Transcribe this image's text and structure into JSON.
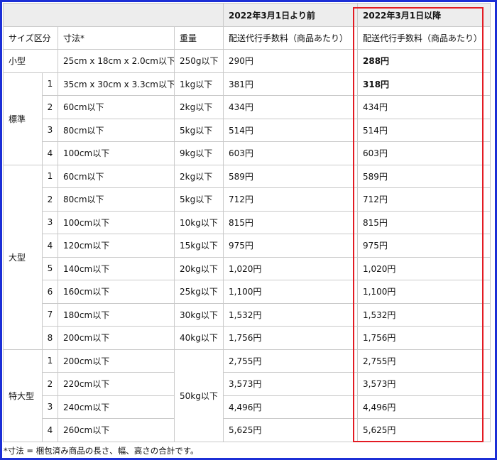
{
  "header": {
    "before_label": "2022年3月1日より前",
    "after_label": "2022年3月1日以降"
  },
  "columns": {
    "size_class": "サイズ区分",
    "dimensions": "寸法*",
    "weight": "重量",
    "fee_before": "配送代行手数料（商品あたり）",
    "fee_after": "配送代行手数料（商品あたり）"
  },
  "small": {
    "label": "小型",
    "dimensions": "25cm x 18cm x 2.0cm以下",
    "weight": "250g以下",
    "fee_before": "290円",
    "fee_after": "288円"
  },
  "standard": {
    "label": "標準",
    "rows": [
      {
        "no": "1",
        "dimensions": "35cm x 30cm x 3.3cm以下",
        "weight": "1kg以下",
        "fee_before": "381円",
        "fee_after": "318円"
      },
      {
        "no": "2",
        "dimensions": "60cm以下",
        "weight": "2kg以下",
        "fee_before": "434円",
        "fee_after": "434円"
      },
      {
        "no": "3",
        "dimensions": "80cm以下",
        "weight": "5kg以下",
        "fee_before": "514円",
        "fee_after": "514円"
      },
      {
        "no": "4",
        "dimensions": "100cm以下",
        "weight": "9kg以下",
        "fee_before": "603円",
        "fee_after": "603円"
      }
    ]
  },
  "large": {
    "label": "大型",
    "rows": [
      {
        "no": "1",
        "dimensions": "60cm以下",
        "weight": "2kg以下",
        "fee_before": "589円",
        "fee_after": "589円"
      },
      {
        "no": "2",
        "dimensions": "80cm以下",
        "weight": "5kg以下",
        "fee_before": "712円",
        "fee_after": "712円"
      },
      {
        "no": "3",
        "dimensions": "100cm以下",
        "weight": "10kg以下",
        "fee_before": "815円",
        "fee_after": "815円"
      },
      {
        "no": "4",
        "dimensions": "120cm以下",
        "weight": "15kg以下",
        "fee_before": "975円",
        "fee_after": "975円"
      },
      {
        "no": "5",
        "dimensions": "140cm以下",
        "weight": "20kg以下",
        "fee_before": "1,020円",
        "fee_after": "1,020円"
      },
      {
        "no": "6",
        "dimensions": "160cm以下",
        "weight": "25kg以下",
        "fee_before": "1,100円",
        "fee_after": "1,100円"
      },
      {
        "no": "7",
        "dimensions": "180cm以下",
        "weight": "30kg以下",
        "fee_before": "1,532円",
        "fee_after": "1,532円"
      },
      {
        "no": "8",
        "dimensions": "200cm以下",
        "weight": "40kg以下",
        "fee_before": "1,756円",
        "fee_after": "1,756円"
      }
    ]
  },
  "oversize": {
    "label": "特大型",
    "weight": "50kg以下",
    "rows": [
      {
        "no": "1",
        "dimensions": "200cm以下",
        "fee_before": "2,755円",
        "fee_after": "2,755円"
      },
      {
        "no": "2",
        "dimensions": "220cm以下",
        "fee_before": "3,573円",
        "fee_after": "3,573円"
      },
      {
        "no": "3",
        "dimensions": "240cm以下",
        "fee_before": "4,496円",
        "fee_after": "4,496円"
      },
      {
        "no": "4",
        "dimensions": "260cm以下",
        "fee_before": "5,625円",
        "fee_after": "5,625円"
      }
    ]
  },
  "footnote": "*寸法 = 梱包済み商品の長さ、幅、高さの合計です。",
  "colors": {
    "frame_border": "#1c2fd6",
    "highlight_border": "#e31b23",
    "header_bg": "#ededed",
    "grid_line": "#c9c9c9"
  }
}
